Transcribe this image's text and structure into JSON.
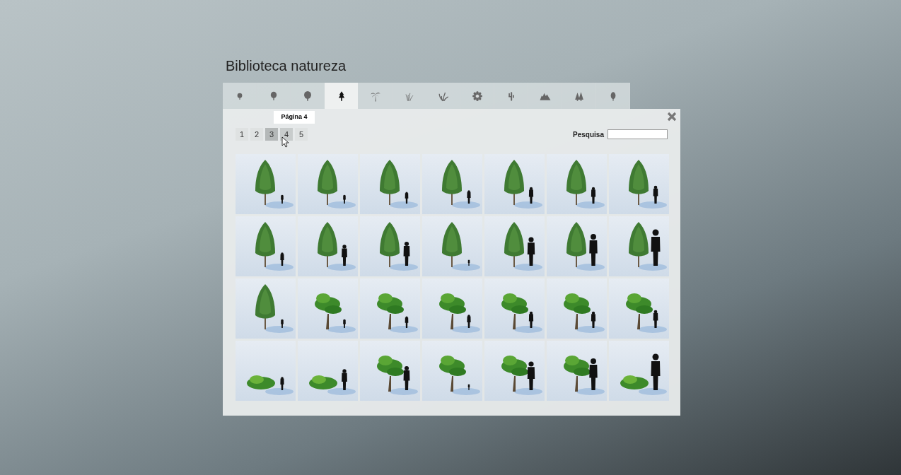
{
  "title": "Biblioteca natureza",
  "tabs": [
    {
      "kind": "small-tree",
      "selected": false
    },
    {
      "kind": "medium-tree",
      "selected": false
    },
    {
      "kind": "large-tree",
      "selected": false
    },
    {
      "kind": "conifer",
      "selected": true
    },
    {
      "kind": "palm",
      "selected": false
    },
    {
      "kind": "grass",
      "selected": false
    },
    {
      "kind": "plant",
      "selected": false
    },
    {
      "kind": "flower",
      "selected": false
    },
    {
      "kind": "cactus",
      "selected": false
    },
    {
      "kind": "rocks",
      "selected": false
    },
    {
      "kind": "conifers",
      "selected": false
    },
    {
      "kind": "shrub",
      "selected": false
    }
  ],
  "tooltip": "Página 4",
  "pages": [
    {
      "label": "1",
      "selected": false,
      "hovered": false
    },
    {
      "label": "2",
      "selected": false,
      "hovered": false
    },
    {
      "label": "3",
      "selected": true,
      "hovered": false
    },
    {
      "label": "4",
      "selected": false,
      "hovered": true
    },
    {
      "label": "5",
      "selected": false,
      "hovered": false
    }
  ],
  "search": {
    "label": "Pesquisa"
  },
  "thumbnails": [
    {
      "kind": "conifer"
    },
    {
      "kind": "conifer"
    },
    {
      "kind": "conifer"
    },
    {
      "kind": "conifer"
    },
    {
      "kind": "conifer"
    },
    {
      "kind": "conifer"
    },
    {
      "kind": "conifer"
    },
    {
      "kind": "conifer"
    },
    {
      "kind": "conifer"
    },
    {
      "kind": "conifer"
    },
    {
      "kind": "conifer"
    },
    {
      "kind": "conifer"
    },
    {
      "kind": "conifer"
    },
    {
      "kind": "conifer"
    },
    {
      "kind": "conifer"
    },
    {
      "kind": "bonsai"
    },
    {
      "kind": "bonsai"
    },
    {
      "kind": "bonsai"
    },
    {
      "kind": "bonsai"
    },
    {
      "kind": "bonsai"
    },
    {
      "kind": "bonsai"
    },
    {
      "kind": "shrub"
    },
    {
      "kind": "shrub"
    },
    {
      "kind": "bonsai"
    },
    {
      "kind": "bonsai"
    },
    {
      "kind": "bonsai"
    },
    {
      "kind": "bonsai"
    },
    {
      "kind": "shrub"
    }
  ]
}
